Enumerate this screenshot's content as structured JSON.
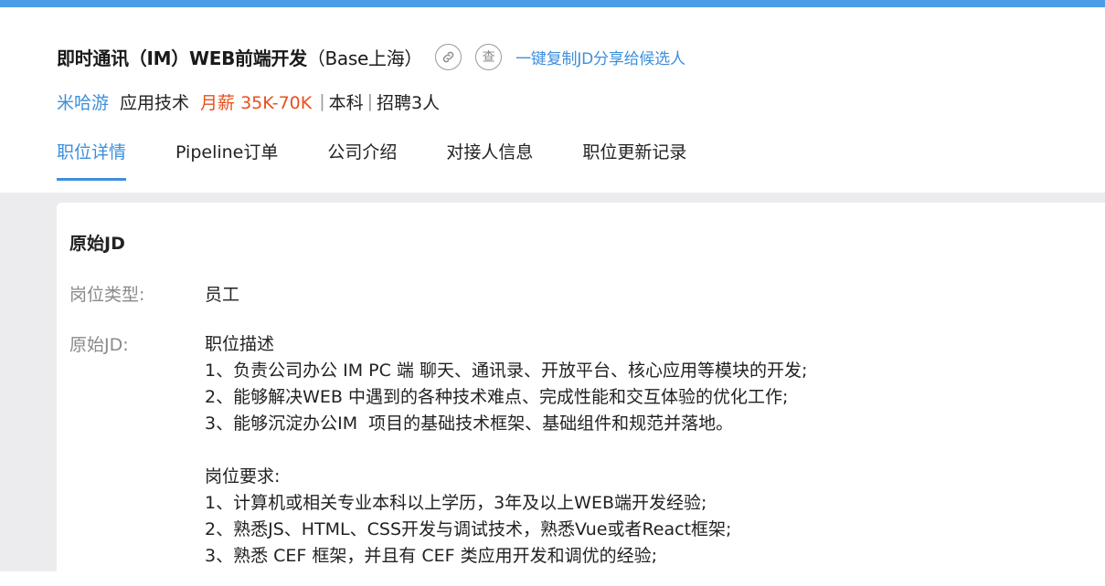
{
  "header": {
    "title_bold": "即时通讯（IM）WEB前端开发",
    "title_suffix": "（Base上海）",
    "link_icon": "link-icon",
    "check_icon_char": "查",
    "copy_link": "一键复制JD分享给候选人"
  },
  "meta": {
    "company": "米哈游",
    "department": "应用技术",
    "salary": "月薪 35K-70K",
    "separator": "|",
    "education": "本科",
    "headcount": "招聘3人"
  },
  "tabs": [
    {
      "label": "职位详情",
      "active": true
    },
    {
      "label": "Pipeline订单",
      "active": false
    },
    {
      "label": "公司介绍",
      "active": false
    },
    {
      "label": "对接人信息",
      "active": false
    },
    {
      "label": "职位更新记录",
      "active": false
    }
  ],
  "card": {
    "section_title": "原始JD",
    "position_type_label": "岗位类型:",
    "position_type_value": "员工",
    "jd_label": "原始JD:",
    "jd_lines": [
      "职位描述",
      "1、负责公司办公 IM PC 端 聊天、通讯录、开放平台、核心应用等模块的开发;",
      "2、能够解决WEB 中遇到的各种技术难点、完成性能和交互体验的优化工作;",
      "3、能够沉淀办公IM  项目的基础技术框架、基础组件和规范并落地。",
      "",
      "岗位要求:",
      "1、计算机或相关专业本科以上学历，3年及以上WEB端开发经验;",
      "2、熟悉JS、HTML、CSS开发与调试技术，熟悉Vue或者React框架;",
      "3、熟悉 CEF 框架，并且有 CEF 类应用开发和调优的经验;"
    ]
  },
  "colors": {
    "accent": "#3d8fdb",
    "top_bar": "#4a9de6",
    "salary": "#e8501c",
    "label_gray": "#8a8a8a",
    "body_bg": "#ececee"
  }
}
